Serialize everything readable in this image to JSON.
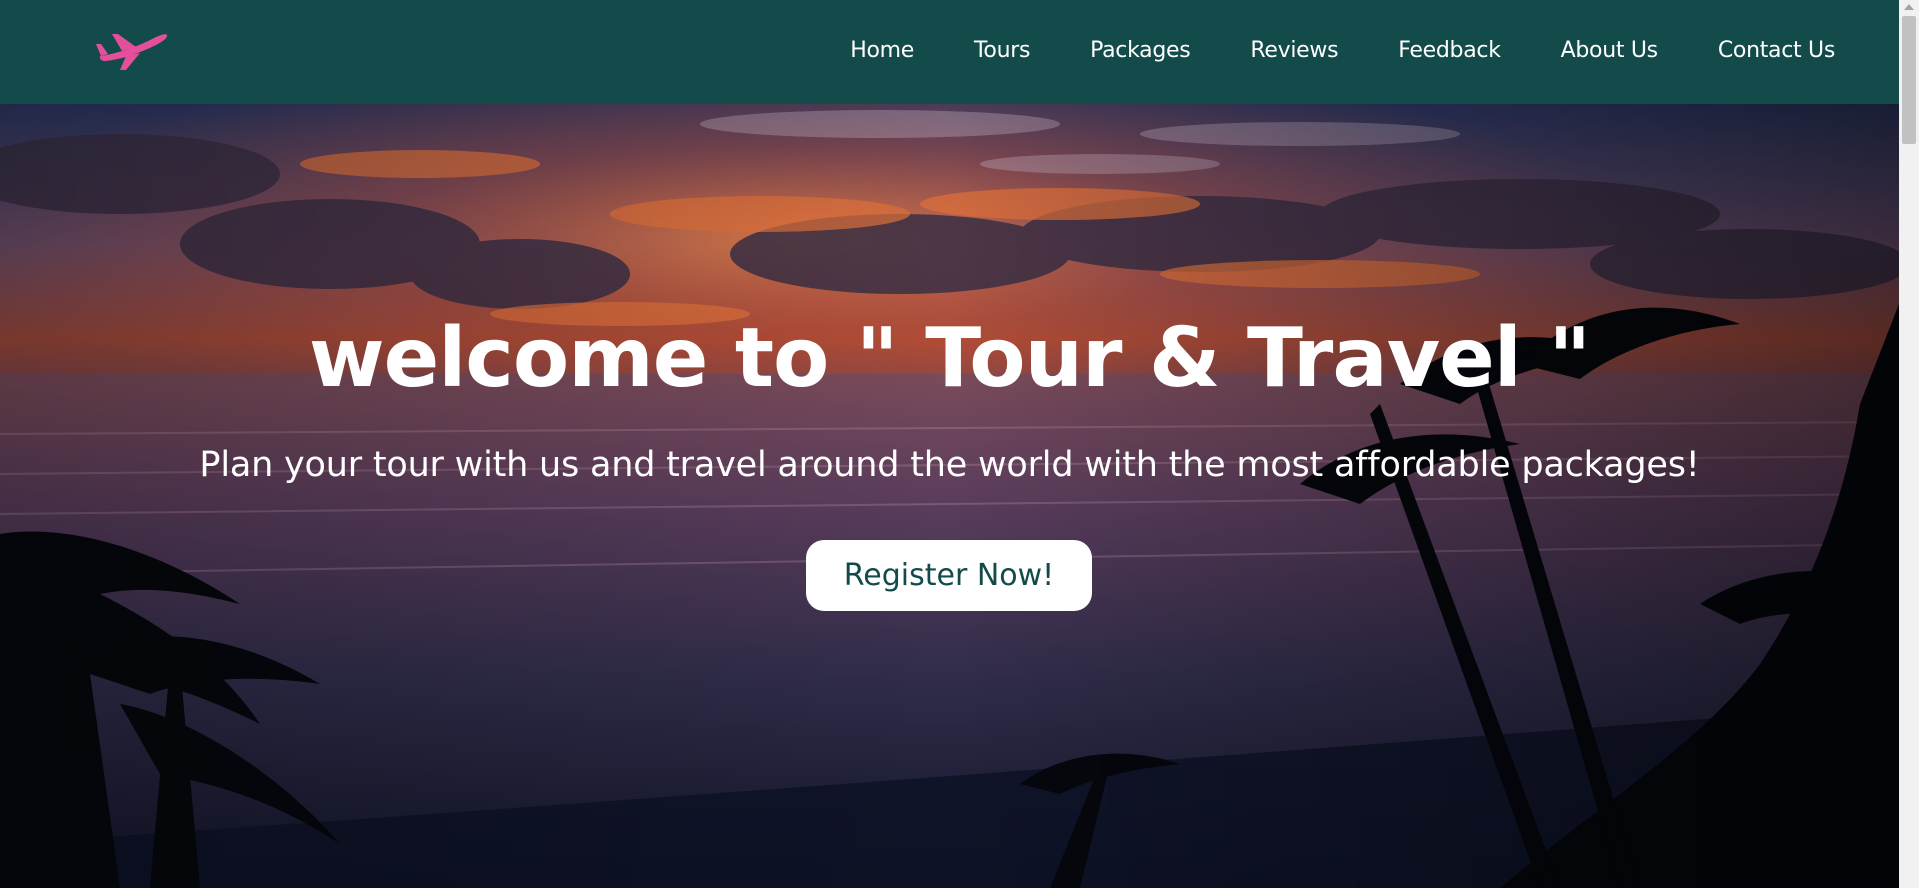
{
  "header": {
    "logo_icon": "airplane-icon",
    "nav": [
      {
        "label": "Home"
      },
      {
        "label": "Tours"
      },
      {
        "label": "Packages"
      },
      {
        "label": "Reviews"
      },
      {
        "label": "Feedback"
      },
      {
        "label": "About Us"
      },
      {
        "label": "Contact Us"
      }
    ]
  },
  "hero": {
    "title": "welcome to \" Tour & Travel \"",
    "subtitle": "Plan your tour with us and travel around the world with the most affordable packages!",
    "cta_label": "Register Now!"
  },
  "colors": {
    "navbar": "#134b4b",
    "logo": "#e34f9a",
    "cta_text": "#134b4b",
    "cta_bg": "#ffffff"
  }
}
